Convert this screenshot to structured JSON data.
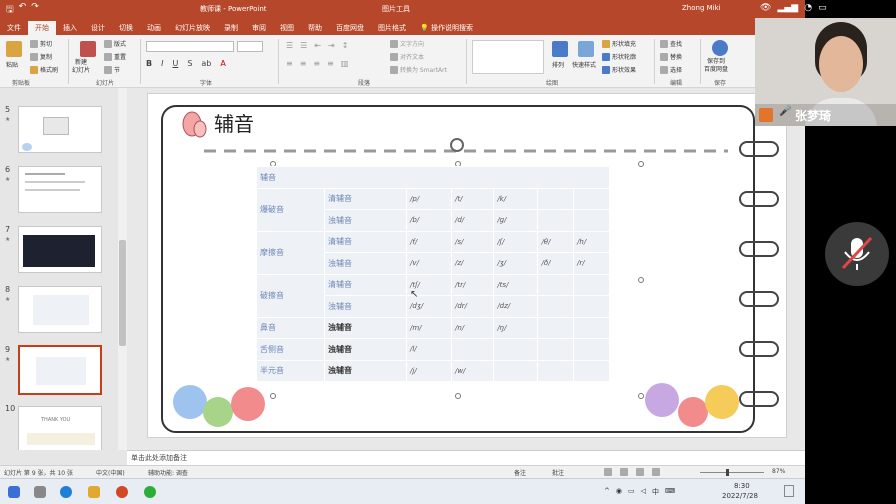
{
  "window": {
    "title": "教师课 - PowerPoint",
    "context_tab": "图片工具",
    "user": "Zhong Miki"
  },
  "tabs": [
    "文件",
    "开始",
    "插入",
    "设计",
    "切换",
    "动画",
    "幻灯片放映",
    "录制",
    "审阅",
    "视图",
    "帮助",
    "百度网盘",
    "图片格式"
  ],
  "tell_me": "操作说明搜索",
  "ribbon": {
    "clipboard": {
      "paste": "粘贴",
      "cut": "剪切",
      "copy": "复制",
      "format_painter": "格式刷",
      "label": "剪贴板"
    },
    "slides": {
      "new_slide": "新建\n幻灯片",
      "layout": "版式",
      "reset": "重置",
      "section": "节",
      "label": "幻灯片"
    },
    "font": {
      "label": "字体"
    },
    "paragraph": {
      "text_direction": "文字方向",
      "align_text": "对齐文本",
      "smartart": "转换为 SmartArt",
      "label": "段落"
    },
    "drawing": {
      "arrange": "排列",
      "quick_styles": "快速样式",
      "fill": "形状填充",
      "outline": "形状轮廓",
      "effects": "形状效果",
      "label": "绘图"
    },
    "editing": {
      "find": "查找",
      "replace": "替换",
      "select": "选择",
      "label": "编辑"
    },
    "save": {
      "save_baidu": "保存到\n百度网盘",
      "label": "保存"
    }
  },
  "thumbnails": [
    {
      "num": "5"
    },
    {
      "num": "6"
    },
    {
      "num": "7"
    },
    {
      "num": "8"
    },
    {
      "num": "9"
    },
    {
      "num": "10",
      "text": "THANK YOU"
    }
  ],
  "slide": {
    "title": "辅音",
    "table": {
      "header": "辅音",
      "rows": [
        {
          "cat": "爆破音",
          "sub": "清辅音",
          "ph": [
            "/p/",
            "/t/",
            "/k/",
            "",
            ""
          ]
        },
        {
          "cat": "",
          "sub": "浊辅音",
          "ph": [
            "/b/",
            "/d/",
            "/g/",
            "",
            ""
          ]
        },
        {
          "cat": "摩擦音",
          "sub": "清辅音",
          "ph": [
            "/f/",
            "/s/",
            "/ʃ/",
            "/θ/",
            "/h/"
          ]
        },
        {
          "cat": "",
          "sub": "浊辅音",
          "ph": [
            "/v/",
            "/z/",
            "/ʒ/",
            "/ð/",
            "/r/"
          ]
        },
        {
          "cat": "破擦音",
          "sub": "清辅音",
          "ph": [
            "/tʃ/",
            "/tr/",
            "/ts/",
            "",
            ""
          ]
        },
        {
          "cat": "",
          "sub": "浊辅音",
          "ph": [
            "/dʒ/",
            "/dr/",
            "/dz/",
            "",
            ""
          ]
        },
        {
          "cat": "鼻音",
          "sub": "浊辅音",
          "ph": [
            "/m/",
            "/n/",
            "/ŋ/",
            "",
            ""
          ]
        },
        {
          "cat": "舌侧音",
          "sub": "浊辅音",
          "ph": [
            "/l/",
            "",
            "",
            "",
            ""
          ]
        },
        {
          "cat": "半元音",
          "sub": "浊辅音",
          "ph": [
            "/j/",
            "/w/",
            "",
            "",
            ""
          ]
        }
      ]
    }
  },
  "notes": "单击此处添加备注",
  "status": {
    "slide_info": "幻灯片 第 9 张，共 10 张",
    "language": "中文(中国)",
    "accessibility": "辅助功能: 调查",
    "notes_btn": "备注",
    "comments_btn": "批注",
    "zoom": "87%"
  },
  "taskbar": {
    "time": "8:30",
    "date": "2022/7/28",
    "ime": "中"
  },
  "video": {
    "participant": "张梦琦"
  },
  "colors": {
    "accent": "#b7472a",
    "table_bg": "#eef2f7",
    "table_text": "#6d86b8"
  }
}
